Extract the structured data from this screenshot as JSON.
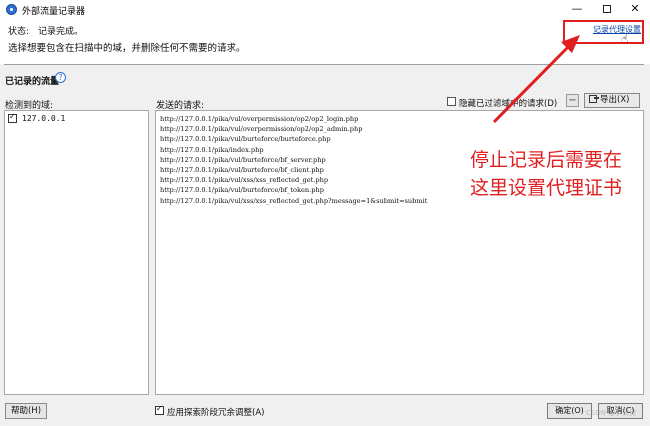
{
  "window": {
    "title": "外部流量记录器",
    "controls": {
      "minimize": "—",
      "close": "✕"
    }
  },
  "status": {
    "label": "状态:",
    "value": "记录完成。",
    "instruction": "选择想要包含在扫描中的域，并删除任何不需要的请求。",
    "proxy_link": "记录代理设置"
  },
  "traffic": {
    "title": "已记录的流量",
    "help": "?",
    "domains_label": "检测到的域:",
    "requests_label": "发送的请求:",
    "hide_filtered_label": "隐藏已过滤域中的请求(D)",
    "remove_button": "−",
    "export_button": "导出(X)",
    "domains": [
      "127.0.0.1"
    ],
    "requests": [
      "http://127.0.0.1/pika/vul/overpermission/op2/op2_login.php",
      "http://127.0.0.1/pika/vul/overpermission/op2/op2_admin.php",
      "http://127.0.0.1/pika/vul/burteforce/burteforce.php",
      "http://127.0.0.1/pika/index.php",
      "http://127.0.0.1/pika/vul/burteforce/bf_server.php",
      "http://127.0.0.1/pika/vul/burteforce/bf_client.php",
      "http://127.0.0.1/pika/vul/xss/xss_reflected_get.php",
      "http://127.0.0.1/pika/vul/burteforce/bf_token.php",
      "http://127.0.0.1/pika/vul/xss/xss_reflected_get.php?message=1&submit=submit"
    ]
  },
  "annotation": {
    "line1": "停止记录后需要在",
    "line2": "这里设置代理证书",
    "color": "#e02020"
  },
  "footer": {
    "help_button": "帮助(H)",
    "optimize_label": "应用探索阶段冗余调整(A)",
    "ok_button": "确定(O)",
    "cancel_button": "取消(C)",
    "watermark": "CSDN @夕须臾"
  }
}
